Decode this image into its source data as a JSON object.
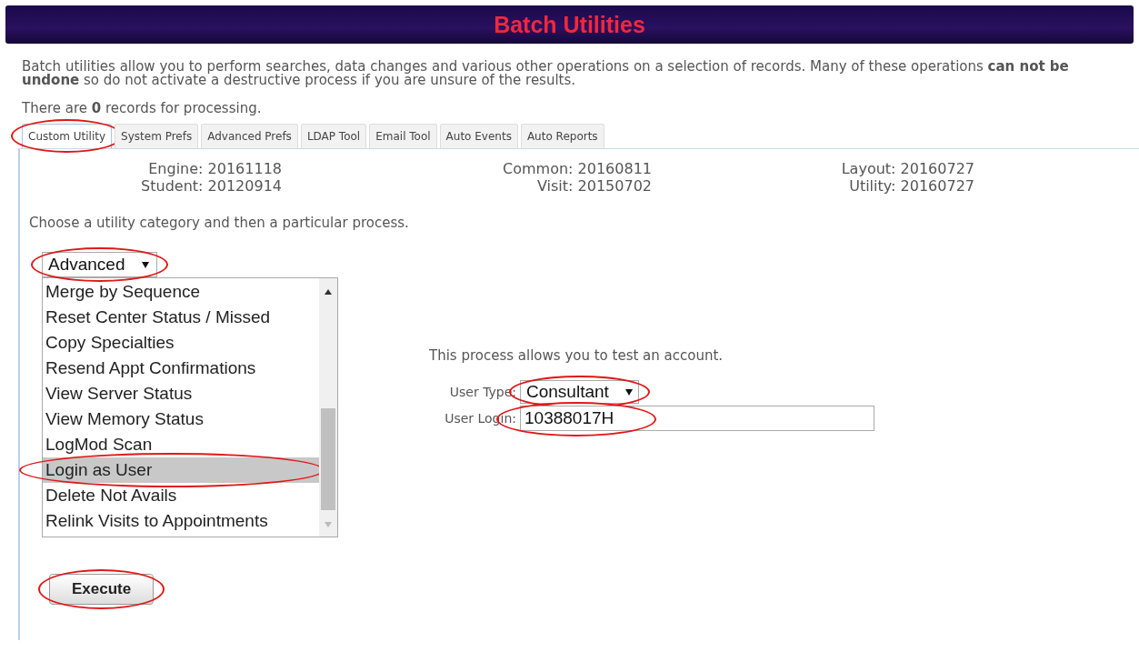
{
  "title": "Batch Utilities",
  "intro": "Batch utilities allow you to perform searches, data changes and various other operations on a selection of records. Many of these operations **can not be undone** so do not activate a destructive process if you are unsure of the results.",
  "record_count": "There are **0** records for processing.",
  "tabs": [
    {
      "label": "Custom Utility",
      "selected": true,
      "circled": true
    },
    {
      "label": "System Prefs",
      "selected": false,
      "circled": false
    },
    {
      "label": "Advanced Prefs",
      "selected": false,
      "circled": false
    },
    {
      "label": "LDAP Tool",
      "selected": false,
      "circled": false
    },
    {
      "label": "Email Tool",
      "selected": false,
      "circled": false
    },
    {
      "label": "Auto Events",
      "selected": false,
      "circled": false
    },
    {
      "label": "Auto Reports",
      "selected": false,
      "circled": false
    }
  ],
  "versions": [
    "Engine: 20161118",
    "Common: 20160811",
    "Layout: 20160727",
    "Student: 20120914",
    "Visit: 20150702",
    "Utility: 20160727"
  ],
  "instruction": "Choose a utility category and then a particular process.",
  "category": {
    "value": "Advanced",
    "circled": true
  },
  "processes": [
    {
      "label": "Merge by Sequence",
      "selected": false,
      "circled": false
    },
    {
      "label": "Reset Center Status / Missed",
      "selected": false,
      "circled": false
    },
    {
      "label": "Copy Specialties",
      "selected": false,
      "circled": false
    },
    {
      "label": "Resend Appt Confirmations",
      "selected": false,
      "circled": false
    },
    {
      "label": "View Server Status",
      "selected": false,
      "circled": false
    },
    {
      "label": "View Memory Status",
      "selected": false,
      "circled": false
    },
    {
      "label": "LogMod Scan",
      "selected": false,
      "circled": false
    },
    {
      "label": "Login as User",
      "selected": true,
      "circled": true
    },
    {
      "label": "Delete Not Avails",
      "selected": false,
      "circled": false
    },
    {
      "label": "Relink Visits to Appointments",
      "selected": false,
      "circled": false
    }
  ],
  "process_description": "This process allows you to test an account.",
  "user_type": {
    "label": "User Type:",
    "value": "Consultant",
    "circled": true
  },
  "user_login": {
    "label": "User Login:",
    "value": "10388017H",
    "circled": true
  },
  "execute": {
    "label": "Execute",
    "circled": true
  }
}
